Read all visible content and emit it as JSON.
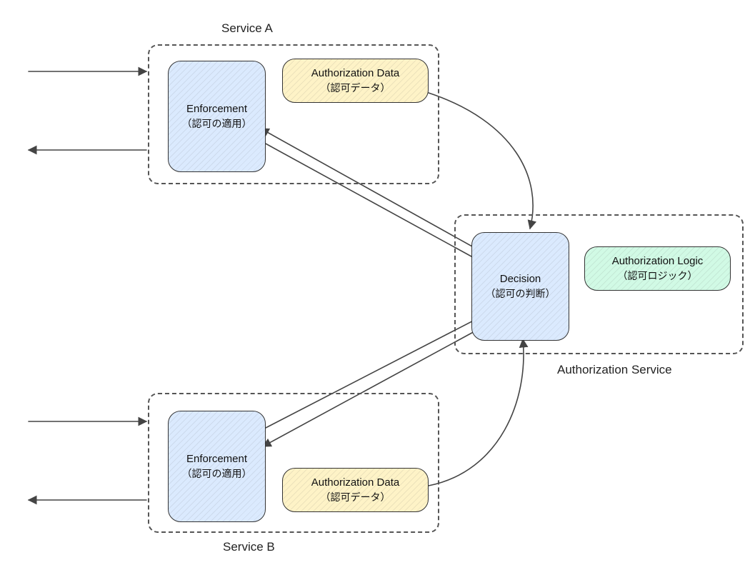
{
  "diagram": {
    "serviceA": {
      "label": "Service A",
      "enforcement": {
        "en": "Enforcement",
        "jp": "（認可の適用）"
      },
      "authData": {
        "en": "Authorization Data",
        "jp": "（認可データ）"
      }
    },
    "serviceB": {
      "label": "Service B",
      "enforcement": {
        "en": "Enforcement",
        "jp": "（認可の適用）"
      },
      "authData": {
        "en": "Authorization Data",
        "jp": "（認可データ）"
      }
    },
    "authService": {
      "label": "Authorization Service",
      "decision": {
        "en": "Decision",
        "jp": "（認可の判断）"
      },
      "authLogic": {
        "en": "Authorization Logic",
        "jp": "（認可ロジック）"
      }
    }
  }
}
